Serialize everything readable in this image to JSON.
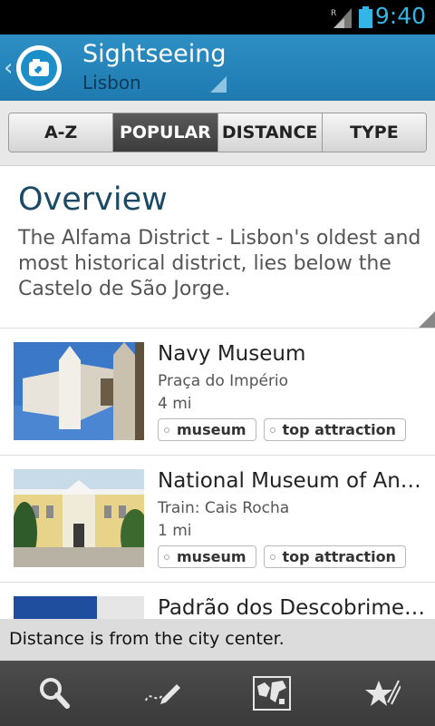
{
  "status_bar": {
    "time": "9:40",
    "signal_icon": "signal-roaming-icon",
    "battery_icon": "battery-icon"
  },
  "action_bar": {
    "back_glyph": "‹",
    "app_icon": "camera-icon",
    "title": "Sightseeing",
    "subtitle": "Lisbon"
  },
  "tabs": [
    {
      "label": "A-Z",
      "active": false
    },
    {
      "label": "POPULAR",
      "active": true
    },
    {
      "label": "DISTANCE",
      "active": false
    },
    {
      "label": "TYPE",
      "active": false
    }
  ],
  "overview": {
    "heading": "Overview",
    "text": "The Alfama District - Lisbon's oldest and most historical district, lies below the Castelo de São Jorge."
  },
  "items": [
    {
      "name": "Navy Museum",
      "address": "Praça do Império",
      "distance": "4 mi",
      "tags": [
        "museum",
        "top attraction"
      ]
    },
    {
      "name": "National Museum of Anci…",
      "address": "Train: Cais Rocha",
      "distance": "1 mi",
      "tags": [
        "museum",
        "top attraction"
      ]
    },
    {
      "name": "Padrão dos Descobrimen…",
      "address": "",
      "distance": "",
      "tags": []
    }
  ],
  "toast": {
    "text": "Distance is from the city center."
  },
  "bottom_bar": {
    "buttons": [
      "search-icon",
      "note-edit-icon",
      "map-icon",
      "favorites-icon"
    ]
  },
  "colors": {
    "accent": "#1f7ab0",
    "status_time": "#33b5e5",
    "heading": "#1b4a66"
  }
}
